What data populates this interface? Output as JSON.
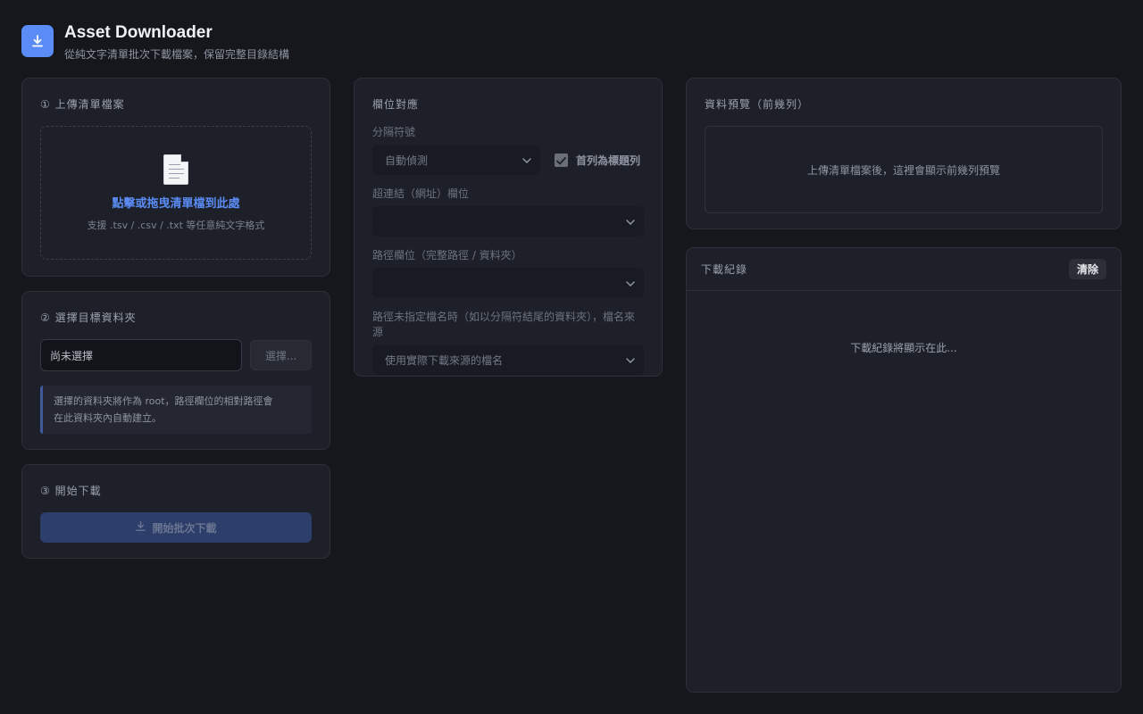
{
  "header": {
    "title": "Asset Downloader",
    "subtitle": "從純文字清單批次下載檔案，保留完整目錄結構"
  },
  "upload": {
    "title": "① 上傳清單檔案",
    "drop_main": "點擊或拖曳清單檔到此處",
    "drop_sub": "支援 .tsv / .csv / .txt 等任意純文字格式"
  },
  "folder": {
    "title": "② 選擇目標資料夾",
    "value": "尚未選擇",
    "choose_label": "選擇...",
    "note_line1": "選擇的資料夾將作為 root，路徑欄位的相對路徑會",
    "note_line2": "在此資料夾內自動建立。"
  },
  "start": {
    "title": "③ 開始下載",
    "button_label": "開始批次下載"
  },
  "mapping": {
    "title": "欄位對應",
    "delimiter_label": "分隔符號",
    "delimiter_value": "自動偵測",
    "header_row_label": "首列為標題列",
    "header_row_checked": true,
    "url_label": "超連結（網址）欄位",
    "url_value": "",
    "path_label": "路徑欄位（完整路徑 / 資料夾）",
    "path_value": "",
    "filename_label": "路徑未指定檔名時（如以分隔符結尾的資料夾），檔名來源",
    "filename_value": "使用實際下載來源的檔名"
  },
  "preview": {
    "title": "資料預覽（前幾列）",
    "placeholder": "上傳清單檔案後，這裡會顯示前幾列預覽"
  },
  "log": {
    "title": "下載紀錄",
    "clear_label": "清除",
    "empty_text": "下載紀錄將顯示在此..."
  },
  "colors": {
    "accent": "#5b8cf6",
    "background": "#15171d",
    "card": "#1d2028"
  },
  "icons": [
    "download-icon",
    "document-icon",
    "chevron-down-icon",
    "checkmark-icon"
  ]
}
